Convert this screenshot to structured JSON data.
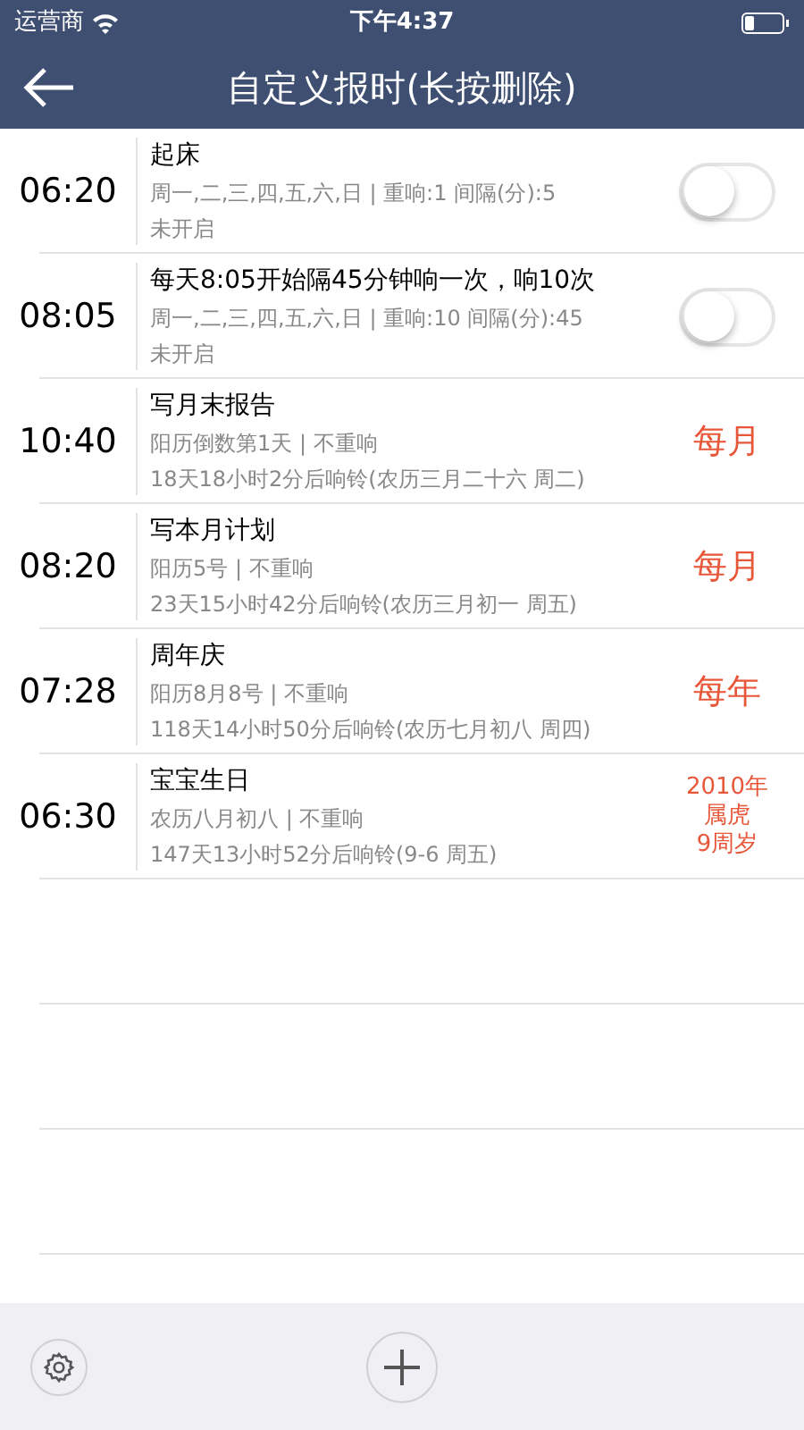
{
  "status_bar": {
    "carrier": "运营商",
    "time": "下午4:37"
  },
  "nav": {
    "title": "自定义报时(长按删除)"
  },
  "alarms": [
    {
      "time": "06:20",
      "title": "起床",
      "detail": "周一,二,三,四,五,六,日 | 重响:1  间隔(分):5",
      "note": "未开启",
      "kind": "toggle",
      "on": false
    },
    {
      "time": "08:05",
      "title": "每天8:05开始隔45分钟响一次，响10次",
      "detail": "周一,二,三,四,五,六,日 | 重响:10  间隔(分):45",
      "note": "未开启",
      "kind": "toggle",
      "on": false
    },
    {
      "time": "10:40",
      "title": "写月末报告",
      "detail": "阳历倒数第1天 | 不重响",
      "note": "18天18小时2分后响铃(农历三月二十六 周二)",
      "kind": "tag",
      "tag": [
        "每月"
      ]
    },
    {
      "time": "08:20",
      "title": "写本月计划",
      "detail": "阳历5号 | 不重响",
      "note": "23天15小时42分后响铃(农历三月初一 周五)",
      "kind": "tag",
      "tag": [
        "每月"
      ]
    },
    {
      "time": "07:28",
      "title": "周年庆",
      "detail": "阳历8月8号 | 不重响",
      "note": "118天14小时50分后响铃(农历七月初八 周四)",
      "kind": "tag",
      "tag": [
        "每年"
      ]
    },
    {
      "time": "06:30",
      "title": "宝宝生日",
      "detail": "农历八月初八 | 不重响",
      "note": "147天13小时52分后响铃(9-6 周五)",
      "kind": "tag",
      "tag": [
        "2010年",
        "属虎",
        "9周岁"
      ]
    }
  ]
}
